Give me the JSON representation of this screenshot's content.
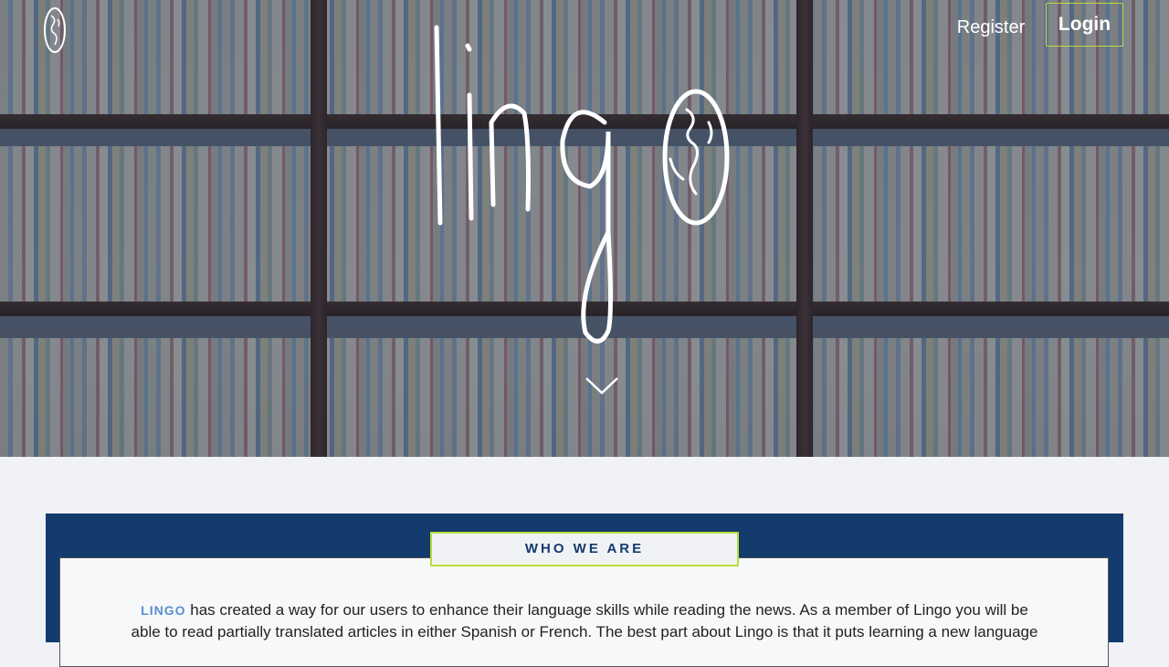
{
  "nav": {
    "logo_icon": "globe-outline-icon",
    "register_label": "Register",
    "login_label": "Login"
  },
  "hero": {
    "logo_text": "lingo",
    "scroll_icon": "chevron-down-icon"
  },
  "who_we_are": {
    "title": "WHO WE ARE",
    "brand": "LINGO",
    "line1": " has created a way for our users to enhance their language skills while reading the news. As a member of Lingo you will be",
    "line2": "able to read partially translated articles in either Spanish or French. The best part about Lingo is that it puts learning a new language"
  },
  "colors": {
    "accent_green": "#b6dd3b",
    "navy": "#133b6e",
    "brand_blue": "#5a8fd1"
  }
}
